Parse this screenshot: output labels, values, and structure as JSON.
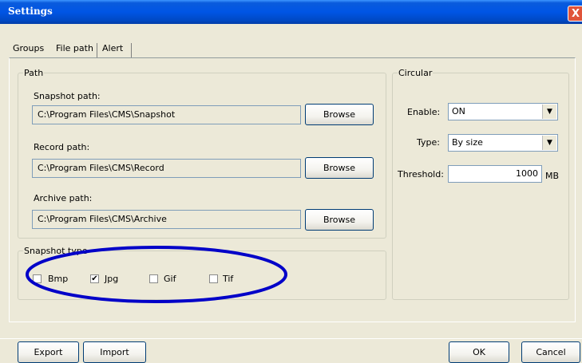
{
  "window": {
    "title": "Settings",
    "close_label": "X"
  },
  "tabs": [
    {
      "label": "Groups"
    },
    {
      "label": "File path"
    },
    {
      "label": "Alert"
    }
  ],
  "path_group": {
    "legend": "Path",
    "snapshot": {
      "label": "Snapshot path:",
      "value": "C:\\Program Files\\CMS\\Snapshot",
      "button": "Browse"
    },
    "record": {
      "label": "Record path:",
      "value": "C:\\Program Files\\CMS\\Record",
      "button": "Browse"
    },
    "archive": {
      "label": "Archive path:",
      "value": "C:\\Program Files\\CMS\\Archive",
      "button": "Browse"
    }
  },
  "snapshot_type": {
    "legend": "Snapshot type",
    "options": [
      {
        "label": "Bmp",
        "checked": false
      },
      {
        "label": "Jpg",
        "checked": true
      },
      {
        "label": "Gif",
        "checked": false
      },
      {
        "label": "Tif",
        "checked": false
      }
    ],
    "highlight_color": "#0000c8"
  },
  "circular": {
    "legend": "Circular",
    "enable": {
      "label": "Enable:",
      "value": "ON"
    },
    "type": {
      "label": "Type:",
      "value": "By size"
    },
    "threshold": {
      "label": "Threshold:",
      "value": "1000",
      "unit": "MB"
    }
  },
  "footer": {
    "export": "Export",
    "import": "Import",
    "ok": "OK",
    "cancel": "Cancel"
  },
  "check_mark": "✔",
  "arrow_glyph": "▼"
}
